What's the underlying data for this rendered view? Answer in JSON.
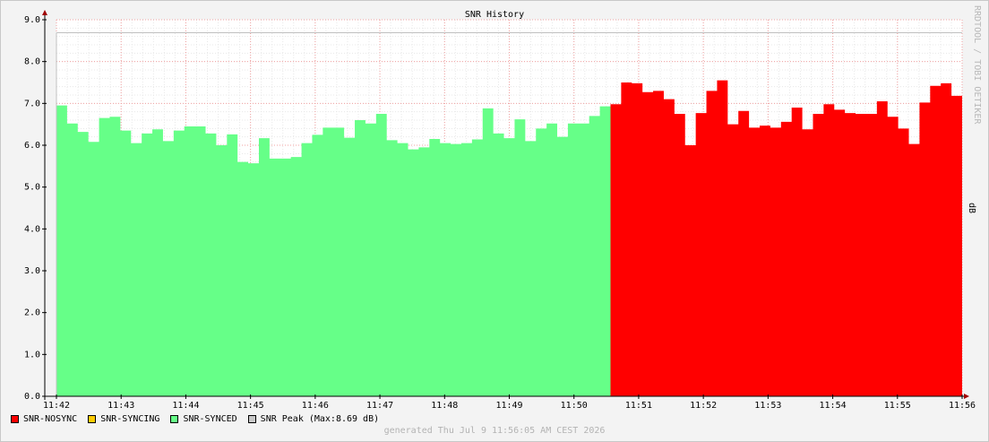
{
  "chart_data": {
    "type": "area",
    "title": "SNR History",
    "ylabel": "dB",
    "watermark": "RRDTOOL / TOBI OETIKER",
    "ylim": [
      0,
      9
    ],
    "y_ticks": [
      "0.0",
      "1.0",
      "2.0",
      "3.0",
      "4.0",
      "5.0",
      "6.0",
      "7.0",
      "8.0",
      "9.0"
    ],
    "x_ticks": [
      "11:42",
      "11:43",
      "11:44",
      "11:45",
      "11:46",
      "11:47",
      "11:48",
      "11:49",
      "11:50",
      "11:51",
      "11:52",
      "11:53",
      "11:54",
      "11:55",
      "11:56"
    ],
    "grid": true,
    "peak": {
      "name": "SNR Peak",
      "value": 8.69,
      "label": "(Max:8.69 dB)"
    },
    "series": [
      {
        "name": "SNR-SYNCED",
        "color": "#66ff88",
        "values": [
          6.95,
          6.52,
          6.32,
          6.08,
          6.65,
          6.68,
          6.35,
          6.05,
          6.28,
          6.38,
          6.1,
          6.35,
          6.45,
          6.45,
          6.28,
          6.0,
          6.26,
          5.6,
          5.57,
          6.17,
          5.68,
          5.68,
          5.72,
          6.05,
          6.25,
          6.42,
          6.42,
          6.18,
          6.6,
          6.52,
          6.75,
          6.12,
          6.05,
          5.9,
          5.95,
          6.15,
          6.05,
          6.03,
          6.05,
          6.14,
          6.88,
          6.28,
          6.17,
          6.62,
          6.1,
          6.4,
          6.52,
          6.2,
          6.52,
          6.52,
          6.7,
          6.93
        ]
      },
      {
        "name": "SNR-NOSYNC",
        "color": "#ff0000",
        "values": [
          6.98,
          7.5,
          7.48,
          7.27,
          7.3,
          7.1,
          6.75,
          6.0,
          6.77,
          7.3,
          7.55,
          6.5,
          6.82,
          6.42,
          6.47,
          6.42,
          6.56,
          6.9,
          6.38,
          6.75,
          6.98,
          6.85,
          6.77,
          6.75,
          6.75,
          7.05,
          6.68,
          6.4,
          6.03,
          7.02,
          7.42,
          7.48,
          7.18
        ]
      },
      {
        "name": "SNR-SYNCING",
        "color": "#ffcc00",
        "values": []
      }
    ]
  },
  "legend": [
    {
      "label": "SNR-NOSYNC",
      "color": "#ff0000"
    },
    {
      "label": "SNR-SYNCING",
      "color": "#ffcc00"
    },
    {
      "label": "SNR-SYNCED",
      "color": "#66ff88"
    },
    {
      "label": "SNR Peak",
      "color": "#c8c8c8"
    }
  ],
  "peak_label": "(Max:8.69 dB)",
  "footer": "generated Thu Jul  9 11:56:05 AM CEST 2026"
}
